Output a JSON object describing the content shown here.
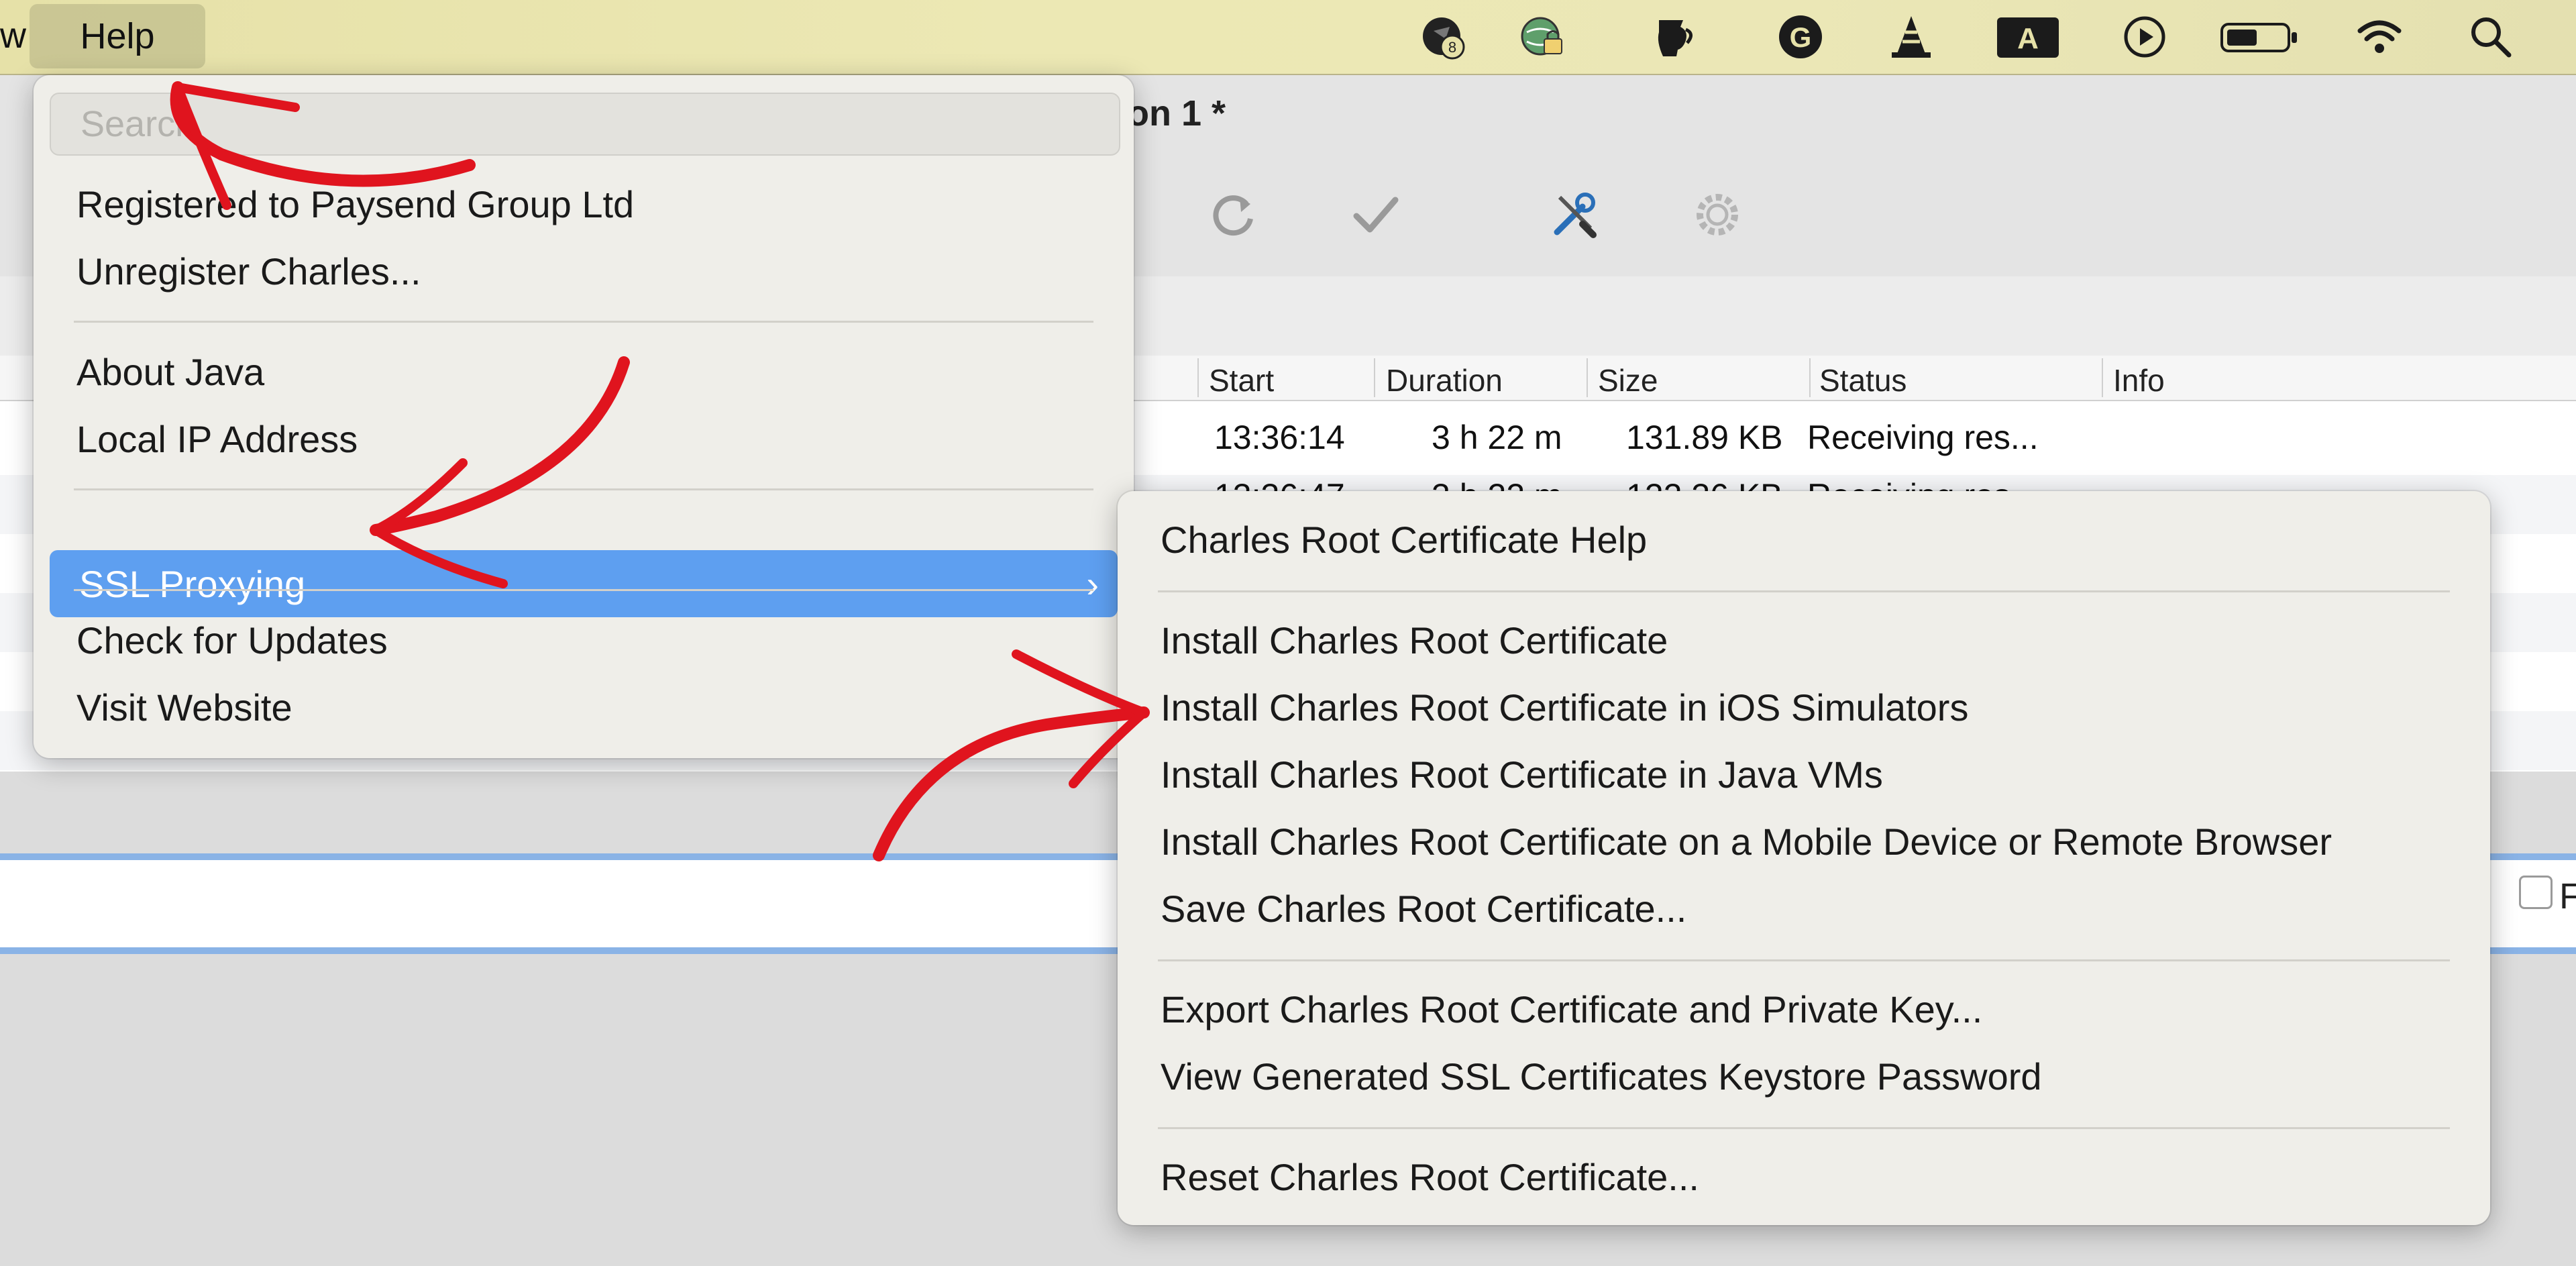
{
  "menubar": {
    "prev_item_fragment": "w",
    "help_label": "Help",
    "status_icons": [
      {
        "name": "notification-badge-icon",
        "badge": "8"
      },
      {
        "name": "vpn-globe-lock-icon"
      },
      {
        "name": "jug-icon"
      },
      {
        "name": "grammarly-icon",
        "glyph": "G"
      },
      {
        "name": "vlc-cone-icon"
      },
      {
        "name": "input-source-icon",
        "glyph": "A"
      },
      {
        "name": "play-circle-icon"
      },
      {
        "name": "battery-icon"
      },
      {
        "name": "wifi-icon"
      },
      {
        "name": "spotlight-search-icon"
      }
    ]
  },
  "window": {
    "title_fragment": "on 1 *",
    "toolbar": [
      {
        "name": "refresh-icon"
      },
      {
        "name": "validate-check-icon"
      },
      {
        "name": "tools-icon"
      },
      {
        "name": "settings-gear-icon"
      }
    ],
    "table": {
      "columns": [
        "Start",
        "Duration",
        "Size",
        "Status",
        "Info"
      ],
      "rows": [
        {
          "start": "13:36:14",
          "duration": "3 h 22 m",
          "size": "131.89 KB",
          "status": "Receiving res...",
          "info": ""
        },
        {
          "start": "13:36:47",
          "duration": "3 h 22 m",
          "size": "122.36 KB",
          "status": "Receiving res...",
          "info": ""
        }
      ]
    },
    "focus_label": "Foc"
  },
  "help_menu": {
    "search_placeholder": "Search",
    "items": [
      {
        "label": "Registered to Paysend Group Ltd"
      },
      {
        "label": "Unregister Charles..."
      },
      {
        "label": "About Java"
      },
      {
        "label": "Local IP Address"
      },
      {
        "label": "SSL Proxying",
        "submenu": true
      },
      {
        "label": "Check for Updates"
      },
      {
        "label": "Visit Website"
      }
    ],
    "submenu_chevron": "›"
  },
  "ssl_submenu": {
    "items": [
      {
        "label": "Charles Root Certificate Help"
      },
      {
        "label": "Install Charles Root Certificate"
      },
      {
        "label": "Install Charles Root Certificate in iOS Simulators"
      },
      {
        "label": "Install Charles Root Certificate in Java VMs"
      },
      {
        "label": "Install Charles Root Certificate on a Mobile Device or Remote Browser"
      },
      {
        "label": "Save Charles Root Certificate..."
      },
      {
        "label": "Export Charles Root Certificate and Private Key..."
      },
      {
        "label": "View Generated SSL Certificates Keystore Password"
      },
      {
        "label": "Reset Charles Root Certificate..."
      }
    ]
  },
  "annotations": {
    "arrow_color": "#e0141e"
  }
}
